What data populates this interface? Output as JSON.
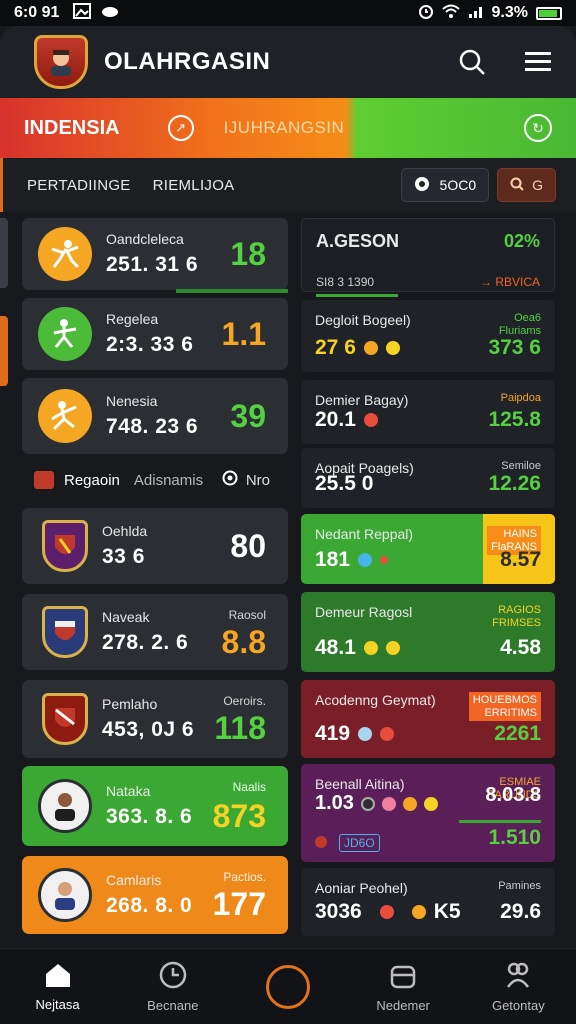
{
  "status_bar": {
    "time": "6:0 91",
    "battery_text": "9.3%"
  },
  "header": {
    "title": "OLAHRGASIN"
  },
  "banner": {
    "left": "INDENSIA",
    "mid": "IJUHRANGSIN"
  },
  "tabs": {
    "items": [
      "PERTADIINGE",
      "RIEMLIJOA"
    ],
    "filter_label": "5OC0",
    "filter2_label": "G"
  },
  "left_cards": [
    {
      "name": "Oandcleleca",
      "sub": "251. 31 6",
      "score": "18",
      "score_color": "#55d041",
      "icon": "player-icon"
    },
    {
      "name": "Regelea",
      "sub": "2:3. 33 6",
      "score": "1.1",
      "score_color": "#f5a623",
      "icon": "player-icon"
    },
    {
      "name": "Nenesia",
      "sub": "748. 23 6",
      "score": "39",
      "score_color": "#55d041",
      "icon": "player-icon"
    },
    {
      "name": "Oehlda",
      "sub": "33 6",
      "score": "80",
      "score_color": "#ffffff",
      "icon": "crest-icon"
    },
    {
      "name": "Naveak",
      "sub": "278. 2. 6",
      "score": "8.8",
      "score_color": "#f5a623",
      "score_label": "Raosol",
      "icon": "crest-icon"
    },
    {
      "name": "Pemlaho",
      "sub": "453, 0J 6",
      "score": "118",
      "score_color": "#55d041",
      "score_label": "Oeroirs.",
      "icon": "crest-icon"
    },
    {
      "name": "Nataka",
      "sub": "363. 8. 6",
      "score": "873",
      "score_color": "#f5d223",
      "score_label": "Naalis",
      "icon": "player-icon"
    },
    {
      "name": "Camlaris",
      "sub": "268. 8. 0",
      "score": "177",
      "score_color": "#ffffff",
      "score_label": "Pactios.",
      "icon": "player-icon"
    }
  ],
  "divider": {
    "left": "Regaoin",
    "alt": "Adisnamis",
    "right": "Nro"
  },
  "right_cards": [
    {
      "title": "A.GESON",
      "sub": "SI8 3 1390",
      "tag": "RBVICA",
      "value": "",
      "rnum": "02%",
      "rnum_color": "#55d041"
    },
    {
      "title": "Degloit Bogeel)",
      "tag": "Oea6\nFluriams",
      "value": "27 6",
      "rnum": "373 6",
      "rnum_color": "#55d041",
      "value_color": "#f5d223"
    },
    {
      "title": "Demier Bagay)",
      "tag": "Paipdoa",
      "value": "20.1",
      "rnum": "125.8",
      "rnum_color": "#55d041",
      "value_color": "#ffffff"
    },
    {
      "title": "Aopait Poagels)",
      "tag": "Semiloe",
      "value": "25.5 0",
      "rnum": "12.26",
      "rnum_color": "#55d041",
      "value_color": "#ffffff"
    },
    {
      "title": "Nedant Reppal)",
      "tag": "HAINS\nFlaRANS",
      "value": "181",
      "rnum": "8.57",
      "rnum_color": "#2b2e33",
      "value_color": "#ffffff"
    },
    {
      "title": "Demeur Ragosl",
      "tag": "RAGIOS\nFRIMSES",
      "value": "48.1",
      "rnum": "4.58",
      "rnum_color": "#ffffff",
      "value_color": "#ffffff"
    },
    {
      "title": "Acodenng Geymat)",
      "tag": "HOUEBMOS\nERRITIMS",
      "value": "419",
      "rnum": "2261",
      "rnum_color": "#55d041",
      "value_color": "#ffffff"
    },
    {
      "title": "Beenall Aitina)",
      "tag": "ESMIAE\nRARUNDS",
      "value": "1.03",
      "rnum": "8.03.8",
      "rnum2": "1.510",
      "rnum_color": "#ffffff",
      "value_color": "#ffffff",
      "chip": "JD6O"
    },
    {
      "title": "Aoniar Peohel)",
      "tag": "Pamines",
      "value": "3036",
      "value2": "K5",
      "rnum": "29.6",
      "rnum_color": "#ffffff",
      "value_color": "#ffffff"
    }
  ],
  "bottom_nav": {
    "items": [
      "Nejtasa",
      "Becnane",
      "",
      "Nedemer",
      "Getontay"
    ]
  }
}
